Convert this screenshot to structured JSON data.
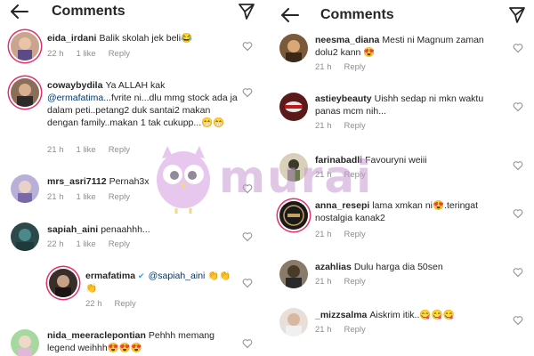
{
  "left": {
    "title": "Comments",
    "comments": [
      {
        "user": "eida_irdani",
        "text": "Balik skolah jek beli😂",
        "time": "22 h",
        "likes": "1 like",
        "reply": "Reply"
      },
      {
        "user": "cowaybydila",
        "text": "Ya ALLAH kak",
        "mention": "@ermafatima",
        "text2": "...fvrite ni...dlu mmg stock ada ja dalam peti..petang2 duk santai2 makan dengan family..makan 1 tak cukupp...😁😁",
        "time": "21 h",
        "likes": "1 like",
        "reply": "Reply"
      },
      {
        "user": "mrs_asri7112",
        "text": "Pernah3x",
        "time": "21 h",
        "likes": "1 like",
        "reply": "Reply"
      },
      {
        "user": "sapiah_aini",
        "text": "penaahhh...",
        "time": "22 h",
        "likes": "1 like",
        "reply": "Reply"
      },
      {
        "user": "ermafatima",
        "verified": "✔",
        "mention": "@sapiah_aini",
        "text": "👏👏👏",
        "time": "22 h",
        "reply": "Reply"
      },
      {
        "user": "nida_meeraclepontian",
        "text": "Pehhh memang legend weihhh😍😍😍"
      }
    ]
  },
  "right": {
    "title": "Comments",
    "comments": [
      {
        "user": "neesma_diana",
        "text": "Mesti ni Magnum zaman dolu2 kann 😍",
        "time": "21 h",
        "reply": "Reply"
      },
      {
        "user": "astieybeauty",
        "text": "Uishh sedap ni  mkn waktu panas mcm nih...",
        "time": "21 h",
        "reply": "Reply"
      },
      {
        "user": "farinabadli",
        "text": "Favouryni weiii",
        "time": "21 h",
        "reply": "Reply"
      },
      {
        "user": "anna_resepi",
        "text": "lama xmkan ni😍.teringat nostalgia kanak2",
        "time": "21 h",
        "reply": "Reply"
      },
      {
        "user": "azahlias",
        "text": "Dulu harga dia 50sen",
        "time": "21 h",
        "reply": "Reply"
      },
      {
        "user": "_mizzsalma",
        "text": "Aiskrim itik..😋😋😋",
        "time": "21 h",
        "reply": "Reply"
      }
    ]
  },
  "watermark": {
    "text": "murai"
  },
  "icons": {
    "back": "arrow-left-icon",
    "send": "paper-plane-icon",
    "like": "heart-outline-icon"
  }
}
